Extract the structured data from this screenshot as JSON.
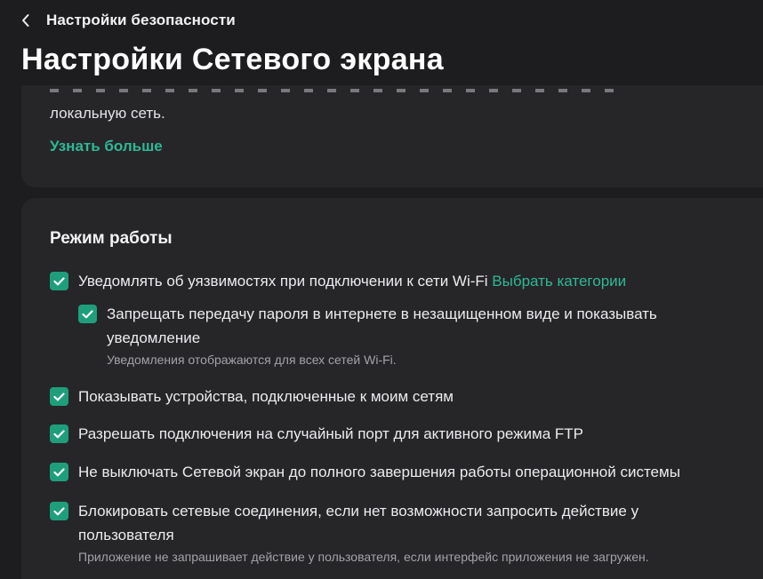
{
  "header": {
    "back_label": "Настройки безопасности",
    "page_title": "Настройки Сетевого экрана"
  },
  "info_card": {
    "description": "локальную сеть.",
    "learn_more": "Узнать больше"
  },
  "mode_section": {
    "title": "Режим работы",
    "options": [
      {
        "text": "Уведомлять об уязвимостях при подключении к сети Wi-Fi",
        "link": "Выбрать категории",
        "checked": true
      },
      {
        "text": "Запрещать передачу пароля в интернете в незащищенном виде и показывать уведомление",
        "hint": "Уведомления отображаются для всех сетей Wi-Fi.",
        "checked": true
      },
      {
        "text": "Показывать устройства, подключенные к моим сетям",
        "checked": true
      },
      {
        "text": "Разрешать подключения на случайный порт для активного режима FTP",
        "checked": true
      },
      {
        "text": "Не выключать Сетевой экран до полного завершения работы операционной системы",
        "checked": true
      },
      {
        "text": "Блокировать сетевые соединения, если нет возможности запросить действие у пользователя",
        "hint": "Приложение не запрашивает действие у пользователя, если интерфейс приложения не загружен.",
        "checked": true
      }
    ]
  },
  "colors": {
    "background": "#1d1d1f",
    "card": "#262629",
    "accent": "#2fb896",
    "checkbox": "#1f9e7c"
  },
  "icons": {
    "back": "chevron-left-icon",
    "checkbox": "checkmark-icon"
  }
}
